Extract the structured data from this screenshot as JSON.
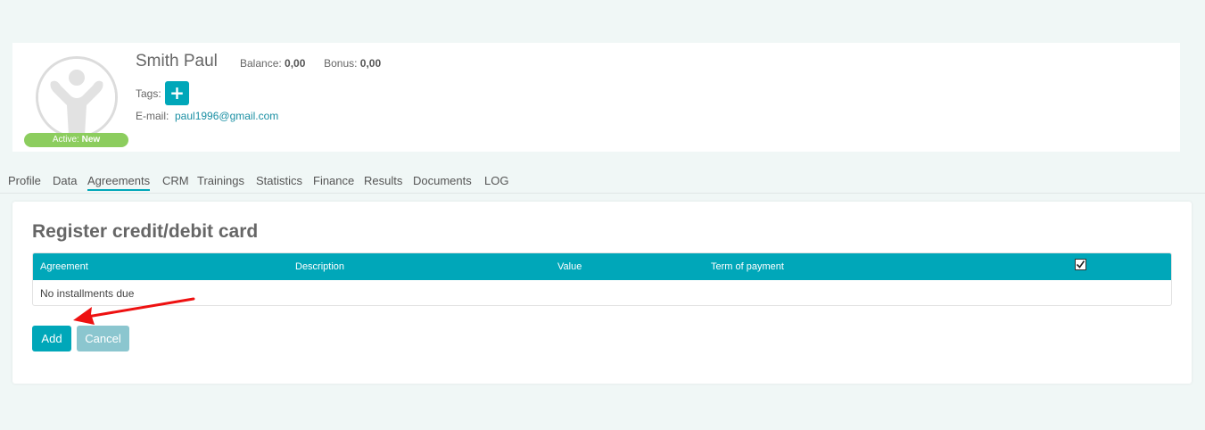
{
  "profile": {
    "name": "Smith Paul",
    "balance_label": "Balance:",
    "balance_value": "0,00",
    "bonus_label": "Bonus:",
    "bonus_value": "0,00",
    "tags_label": "Tags:",
    "tag_add_symbol": "+",
    "email_label": "E-mail:",
    "email": "paul1996@gmail.com",
    "status_label": "Active:",
    "status_value": "New",
    "status_color": "#8ccd5e",
    "avatar_icon": "person-avatar-icon"
  },
  "tabs": [
    {
      "label": "Profile"
    },
    {
      "label": "Data"
    },
    {
      "label": "Agreements",
      "active": true
    },
    {
      "label": "CRM"
    },
    {
      "label": "Trainings"
    },
    {
      "label": "Statistics"
    },
    {
      "label": "Finance"
    },
    {
      "label": "Results"
    },
    {
      "label": "Documents"
    },
    {
      "label": "LOG"
    }
  ],
  "section": {
    "title": "Register credit/debit card",
    "columns": [
      "Agreement",
      "Description",
      "Value",
      "Term of payment"
    ],
    "select_all_checked": true,
    "empty_message": "No installments due"
  },
  "actions": {
    "add_label": "Add",
    "cancel_label": "Cancel"
  },
  "colors": {
    "accent": "#00a7b9",
    "annotation_arrow": "#ee1111"
  }
}
